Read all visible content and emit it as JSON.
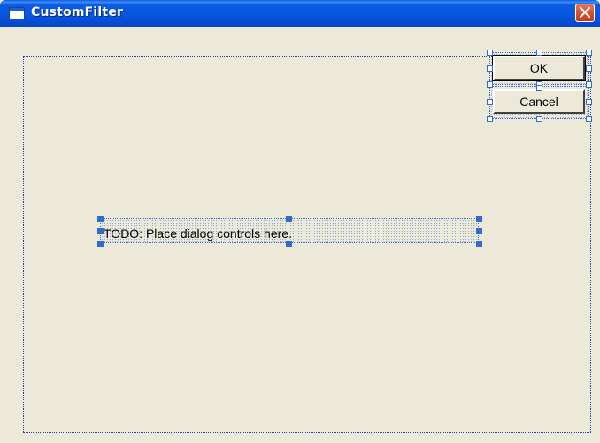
{
  "window": {
    "title": "CustomFilter",
    "icon": "window-icon",
    "close_icon": "close-icon"
  },
  "dialog": {
    "static_text": "TODO: Place dialog controls here.",
    "ok_label": "OK",
    "cancel_label": "Cancel"
  },
  "colors": {
    "titlebar": "#0a5ce6",
    "dialog_background": "#ece9d8",
    "selection_handle": "#2f6bd1",
    "close_button": "#d9502c"
  }
}
